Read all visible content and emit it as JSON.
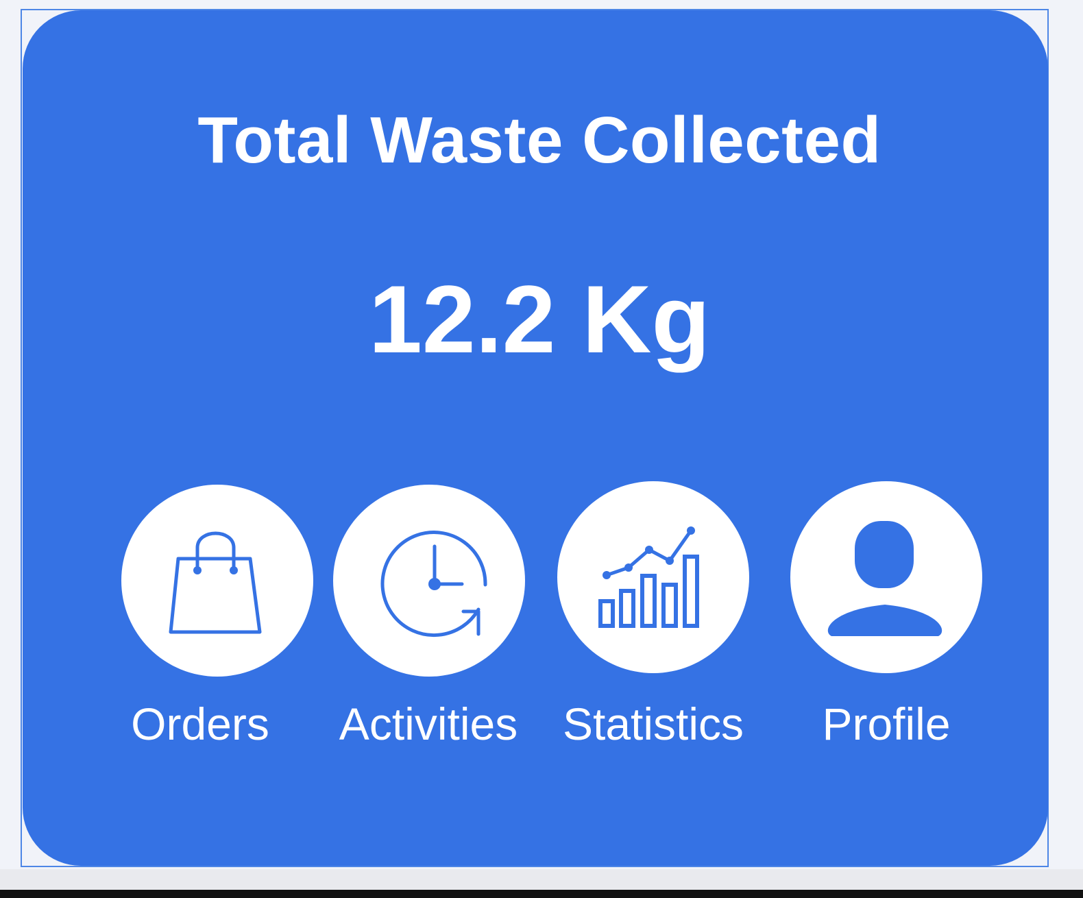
{
  "card": {
    "title": "Total Waste Collected",
    "value": "12.2 Kg"
  },
  "nav": [
    {
      "label": "Orders",
      "icon": "shopping-bag-icon"
    },
    {
      "label": "Activities",
      "icon": "clock-history-icon"
    },
    {
      "label": "Statistics",
      "icon": "bar-chart-trend-icon"
    },
    {
      "label": "Profile",
      "icon": "user-profile-icon"
    }
  ],
  "colors": {
    "card_background": "#3572e4",
    "page_background": "#f1f3f9",
    "icon_circle": "#ffffff",
    "text": "#ffffff"
  }
}
